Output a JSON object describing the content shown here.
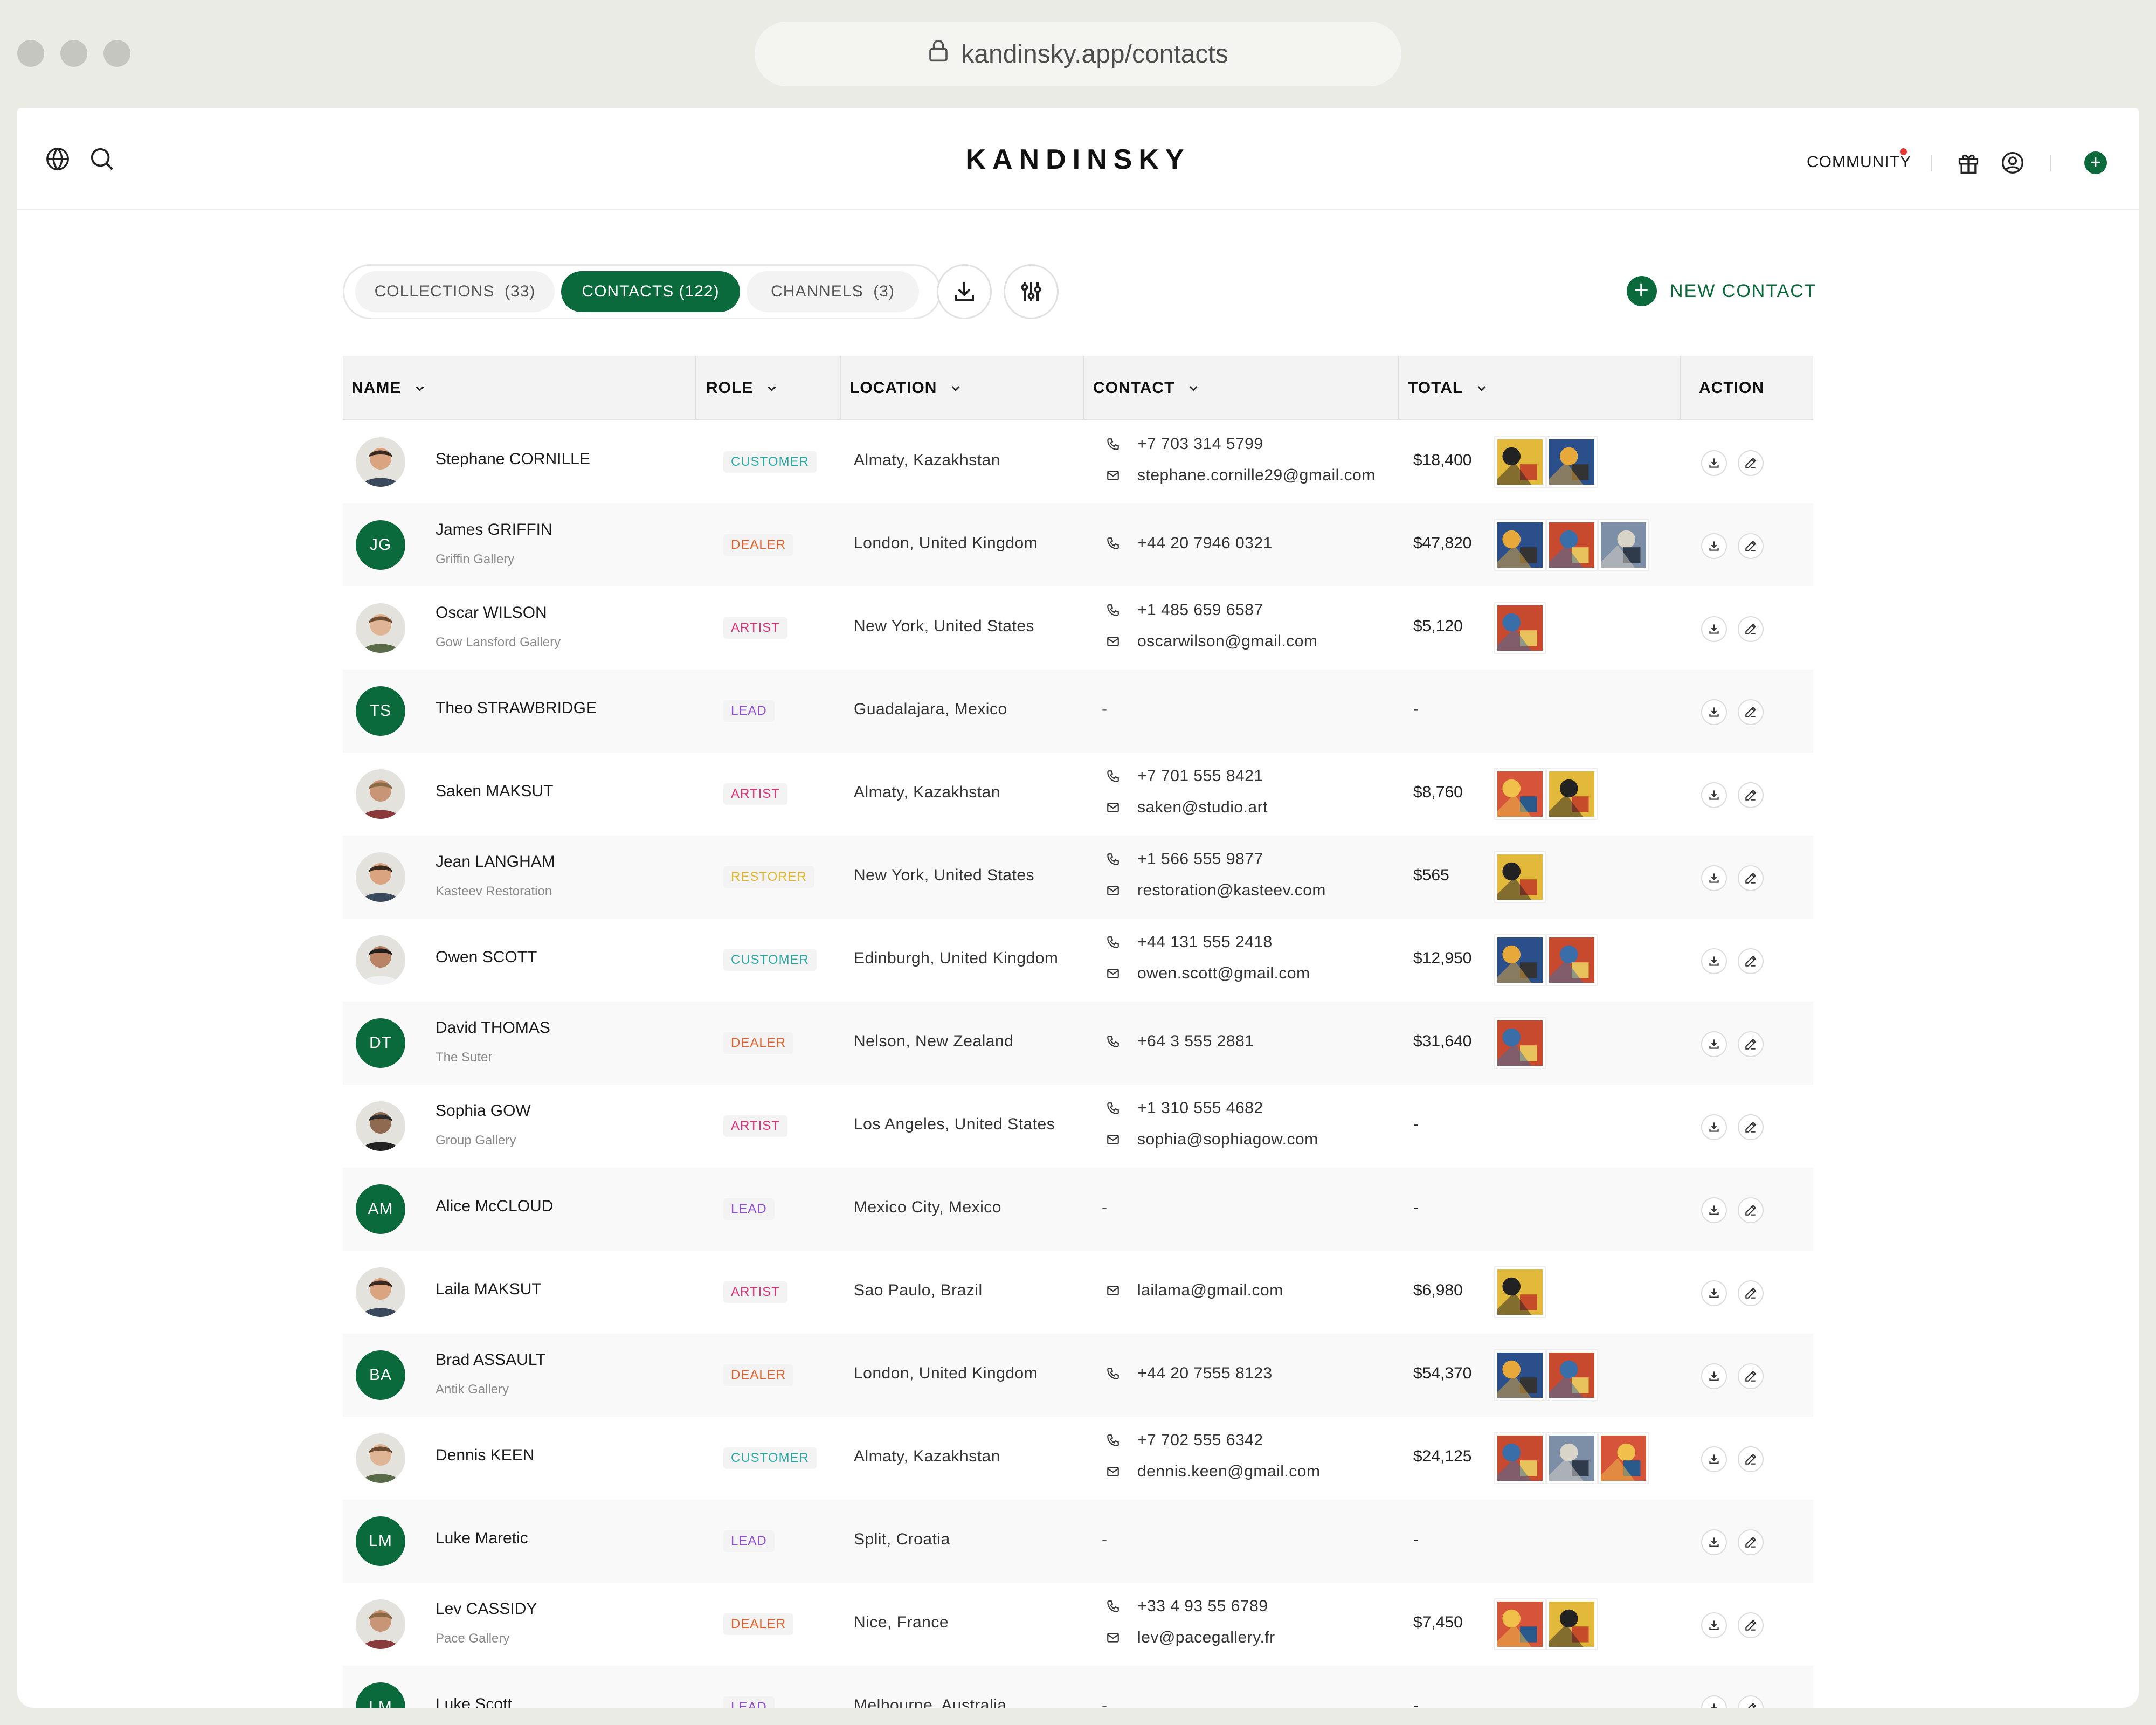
{
  "browser": {
    "url": "kandinsky.app/contacts"
  },
  "header": {
    "brand": "KANDINSKY",
    "community": "COMMUNITY"
  },
  "tabs": [
    {
      "label": "COLLECTIONS",
      "count": "(33)"
    },
    {
      "label": "CONTACTS",
      "count": "(122)"
    },
    {
      "label": "CHANNELS",
      "count": "(3)"
    }
  ],
  "new_contact_label": "NEW CONTACT",
  "columns": [
    "NAME",
    "ROLE",
    "LOCATION",
    "CONTACT",
    "TOTAL",
    "ACTION"
  ],
  "role_colors": {
    "CUSTOMER": "#2aa7a0",
    "DEALER": "#e2622b",
    "ARTIST": "#d9337a",
    "LEAD": "#8e4fd0",
    "RESTORER": "#e0b62a"
  },
  "contacts": [
    {
      "name": "Stephane CORNILLE",
      "org": "",
      "initials": "",
      "role": "CUSTOMER",
      "location": "Almaty, Kazakhstan",
      "phone": "+7 703 314 5799",
      "email": "stephane.cornille29@gmail.com",
      "total": "$18,400",
      "artworks": 2
    },
    {
      "name": "James GRIFFIN",
      "org": "Griffin Gallery",
      "initials": "JG",
      "role": "DEALER",
      "location": "London, United Kingdom",
      "phone": "+44 20 7946 0321",
      "email": "",
      "total": "$47,820",
      "artworks": 3
    },
    {
      "name": "Oscar WILSON",
      "org": "Gow Lansford Gallery",
      "initials": "",
      "role": "ARTIST",
      "location": "New York, United States",
      "phone": "+1 485 659 6587",
      "email": "oscarwilson@gmail.com",
      "total": "$5,120",
      "artworks": 1
    },
    {
      "name": "Theo STRAWBRIDGE",
      "org": "",
      "initials": "TS",
      "role": "LEAD",
      "location": "Guadalajara, Mexico",
      "phone": "",
      "email": "",
      "total": "-",
      "artworks": 0
    },
    {
      "name": "Saken MAKSUT",
      "org": "",
      "initials": "",
      "role": "ARTIST",
      "location": "Almaty, Kazakhstan",
      "phone": "+7 701 555 8421",
      "email": "saken@studio.art",
      "total": "$8,760",
      "artworks": 2
    },
    {
      "name": "Jean LANGHAM",
      "org": "Kasteev Restoration",
      "initials": "",
      "role": "RESTORER",
      "location": "New York, United States",
      "phone": "+1 566 555 9877",
      "email": "restoration@kasteev.com",
      "total": "$565",
      "artworks": 1
    },
    {
      "name": "Owen SCOTT",
      "org": "",
      "initials": "",
      "role": "CUSTOMER",
      "location": "Edinburgh, United Kingdom",
      "phone": "+44 131 555 2418",
      "email": "owen.scott@gmail.com",
      "total": "$12,950",
      "artworks": 2
    },
    {
      "name": "David THOMAS",
      "org": "The Suter",
      "initials": "DT",
      "role": "DEALER",
      "location": "Nelson, New Zealand",
      "phone": "+64 3 555 2881",
      "email": "",
      "total": "$31,640",
      "artworks": 1
    },
    {
      "name": "Sophia GOW",
      "org": "Group Gallery",
      "initials": "",
      "role": "ARTIST",
      "location": "Los Angeles, United States",
      "phone": "+1 310 555 4682",
      "email": "sophia@sophiagow.com",
      "total": "-",
      "artworks": 0
    },
    {
      "name": "Alice McCLOUD",
      "org": "",
      "initials": "AM",
      "role": "LEAD",
      "location": "Mexico City, Mexico",
      "phone": "",
      "email": "",
      "total": "-",
      "artworks": 0
    },
    {
      "name": "Laila MAKSUT",
      "org": "",
      "initials": "",
      "role": "ARTIST",
      "location": "Sao Paulo, Brazil",
      "phone": "",
      "email": "lailama@gmail.com",
      "total": "$6,980",
      "artworks": 1
    },
    {
      "name": "Brad ASSAULT",
      "org": "Antik Gallery",
      "initials": "BA",
      "role": "DEALER",
      "location": "London, United Kingdom",
      "phone": "+44 20 7555 8123",
      "email": "",
      "total": "$54,370",
      "artworks": 2
    },
    {
      "name": "Dennis KEEN",
      "org": "",
      "initials": "",
      "role": "CUSTOMER",
      "location": "Almaty, Kazakhstan",
      "phone": "+7 702 555 6342",
      "email": "dennis.keen@gmail.com",
      "total": "$24,125",
      "artworks": 3
    },
    {
      "name": "Luke Maretic",
      "org": "",
      "initials": "LM",
      "role": "LEAD",
      "location": "Split, Croatia",
      "phone": "",
      "email": "",
      "total": "-",
      "artworks": 0
    },
    {
      "name": "Lev CASSIDY",
      "org": "Pace Gallery",
      "initials": "",
      "role": "DEALER",
      "location": "Nice, France",
      "phone": "+33 4 93 55 6789",
      "email": "lev@pacegallery.fr",
      "total": "$7,450",
      "artworks": 2
    },
    {
      "name": "Luke Scott",
      "org": "",
      "initials": "LM",
      "role": "LEAD",
      "location": "Melbourne, Australia",
      "phone": "",
      "email": "",
      "total": "-",
      "artworks": 0
    }
  ]
}
